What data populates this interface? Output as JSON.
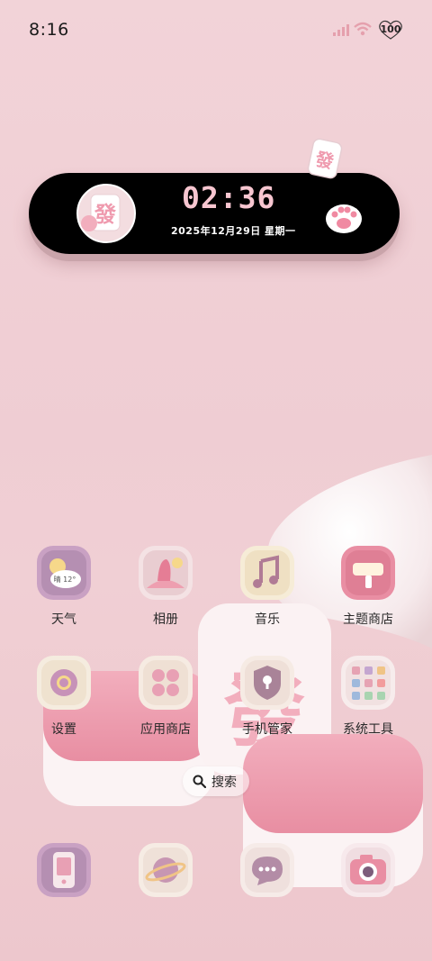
{
  "status_bar": {
    "time": "8:16",
    "battery": "100",
    "signal_icon": "signal-icon",
    "wifi_icon": "wifi-icon",
    "battery_icon": "heart-battery-icon"
  },
  "clock_widget": {
    "time": "02:36",
    "date": "2025年12月29日 星期一",
    "avatar_icon": "mahjong-tile-icon",
    "paw_icon": "paw-icon"
  },
  "apps": {
    "row1": [
      {
        "label": "天气",
        "icon": "weather-icon",
        "icon_text": "晴 12°"
      },
      {
        "label": "相册",
        "icon": "gallery-icon"
      },
      {
        "label": "音乐",
        "icon": "music-icon"
      },
      {
        "label": "主题商店",
        "icon": "theme-store-icon"
      }
    ],
    "row2": [
      {
        "label": "设置",
        "icon": "settings-icon"
      },
      {
        "label": "应用商店",
        "icon": "app-store-icon"
      },
      {
        "label": "手机管家",
        "icon": "phone-manager-icon"
      },
      {
        "label": "系统工具",
        "icon": "system-tools-icon"
      }
    ]
  },
  "search": {
    "label": "搜索",
    "icon": "search-icon"
  },
  "dock": [
    {
      "icon": "phone-icon"
    },
    {
      "icon": "browser-icon"
    },
    {
      "icon": "messages-icon"
    },
    {
      "icon": "camera-icon"
    }
  ],
  "colors": {
    "background": "#efcdd3",
    "widget": "#000000",
    "accent_pink": "#f7c6d0",
    "text": "#2a2a2a"
  }
}
